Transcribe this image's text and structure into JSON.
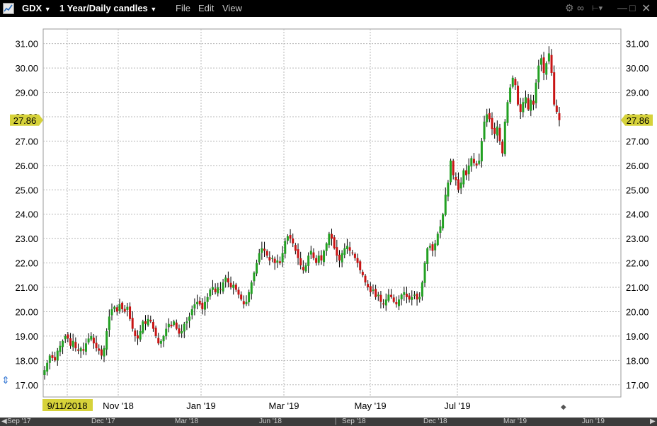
{
  "window": {
    "symbol": "GDX",
    "timeframe": "1 Year/Daily candles",
    "menus": [
      "File",
      "Edit",
      "View"
    ],
    "icons": [
      "gear-icon",
      "link-icon",
      "pin-icon",
      "minimize-icon",
      "maximize-icon",
      "close-icon"
    ]
  },
  "chart_data": {
    "type": "candlestick",
    "symbol": "GDX",
    "period": "1 Year/Daily candles",
    "ylim": [
      16.5,
      31.6
    ],
    "y_ticks": [
      "17.00",
      "18.00",
      "19.00",
      "20.00",
      "21.00",
      "22.00",
      "23.00",
      "24.00",
      "25.00",
      "26.00",
      "27.00",
      "28.00",
      "29.00",
      "30.00",
      "31.00"
    ],
    "x_ticks": [
      "9/11/2018",
      "Nov '18",
      "Jan '19",
      "Mar '19",
      "May '19",
      "Jul '19"
    ],
    "start_date": "9/11/2018",
    "last_price": "27.86",
    "grid": true,
    "up_color": "#22a022",
    "down_color": "#c81414",
    "closes": [
      17.6,
      17.9,
      18.2,
      18.1,
      18.0,
      18.4,
      18.6,
      18.8,
      19.0,
      18.9,
      18.6,
      18.8,
      18.5,
      18.4,
      18.5,
      18.4,
      18.7,
      18.9,
      19.0,
      18.7,
      18.5,
      18.4,
      18.2,
      18.5,
      19.2,
      19.8,
      20.1,
      20.2,
      20.0,
      20.3,
      20.1,
      20.0,
      20.2,
      19.7,
      19.3,
      19.0,
      18.9,
      19.2,
      19.6,
      19.5,
      19.7,
      19.6,
      19.3,
      19.0,
      18.7,
      18.8,
      19.0,
      19.3,
      19.5,
      19.4,
      19.6,
      19.3,
      19.1,
      19.2,
      19.5,
      19.6,
      19.8,
      20.1,
      20.3,
      20.4,
      20.3,
      20.1,
      20.4,
      20.6,
      20.9,
      21.0,
      20.8,
      21.0,
      20.9,
      21.2,
      21.4,
      21.2,
      21.0,
      21.1,
      20.9,
      20.7,
      20.5,
      20.3,
      20.4,
      20.8,
      21.2,
      21.6,
      22.0,
      22.4,
      22.6,
      22.5,
      22.3,
      22.1,
      22.2,
      22.0,
      22.1,
      22.0,
      22.4,
      22.9,
      23.1,
      23.0,
      22.8,
      22.5,
      22.2,
      21.9,
      21.7,
      21.9,
      22.3,
      22.5,
      22.2,
      22.0,
      22.3,
      22.1,
      22.5,
      22.8,
      23.2,
      23.0,
      22.6,
      22.3,
      22.1,
      22.4,
      22.6,
      22.7,
      22.5,
      22.4,
      22.2,
      22.0,
      21.7,
      21.5,
      21.2,
      21.0,
      20.8,
      20.9,
      20.6,
      20.7,
      20.4,
      20.3,
      20.5,
      20.7,
      20.6,
      20.4,
      20.3,
      20.5,
      20.7,
      20.8,
      20.6,
      20.5,
      20.6,
      20.7,
      20.5,
      20.6,
      21.2,
      22.0,
      22.6,
      22.7,
      22.5,
      22.8,
      23.2,
      23.5,
      24.0,
      24.8,
      25.3,
      26.2,
      25.6,
      25.4,
      25.0,
      25.3,
      25.8,
      25.6,
      26.0,
      26.3,
      26.1,
      26.0,
      26.2,
      27.0,
      27.8,
      28.1,
      27.9,
      27.5,
      27.3,
      27.6,
      27.0,
      26.5,
      27.8,
      28.6,
      29.2,
      29.6,
      29.3,
      28.5,
      28.2,
      28.6,
      28.8,
      28.3,
      28.7,
      28.5,
      29.4,
      30.1,
      30.4,
      29.8,
      30.2,
      30.6,
      29.8,
      28.5,
      28.2,
      27.86
    ],
    "last_visible_tick": 0
  }
}
